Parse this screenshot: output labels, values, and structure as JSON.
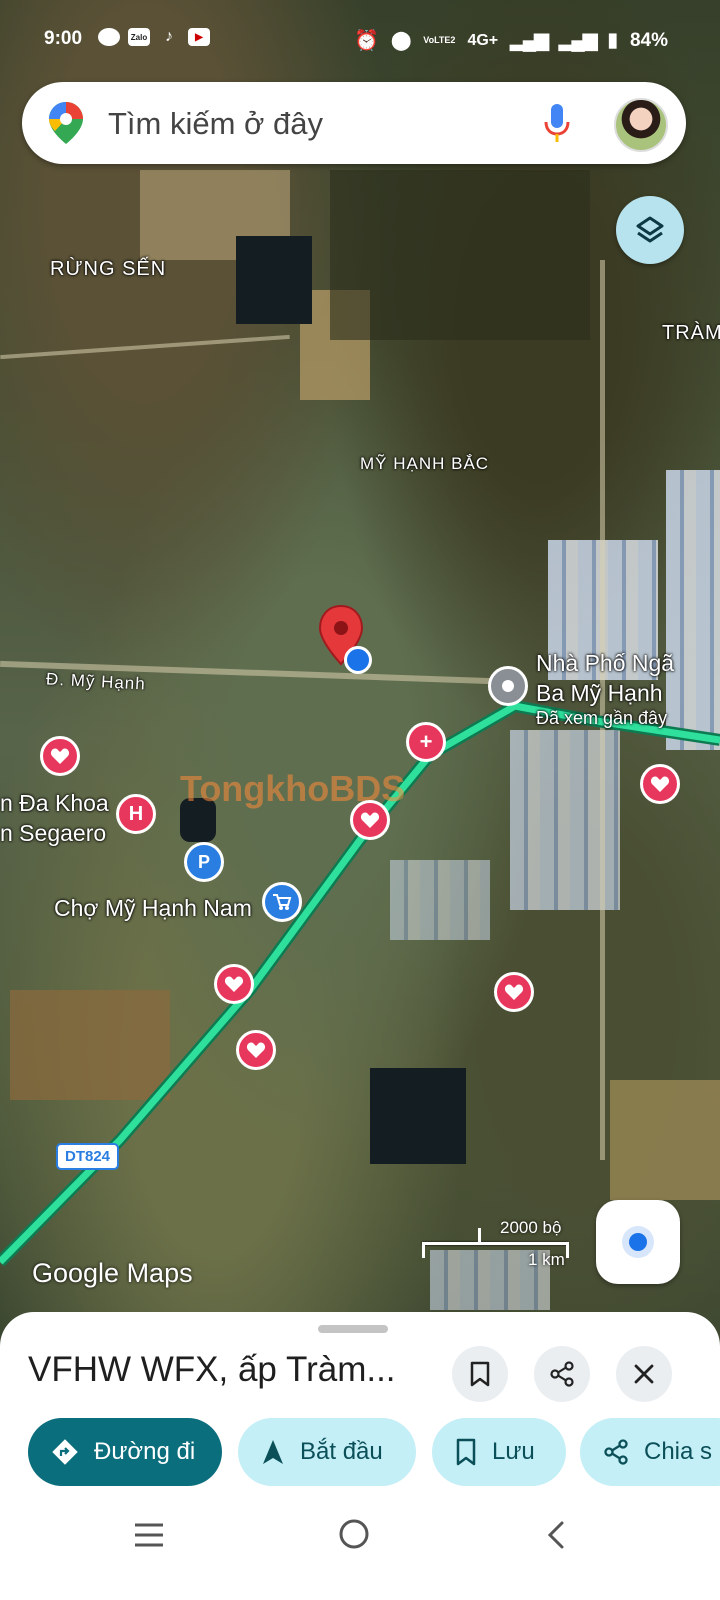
{
  "status_bar": {
    "time": "9:00",
    "app_icons": [
      "chat-icon",
      "zalo-icon",
      "tiktok-icon",
      "youtube-icon"
    ],
    "network": "4G+",
    "volte": "VoLTE2",
    "battery": "84%"
  },
  "search": {
    "placeholder": "Tìm kiếm ở đây"
  },
  "map": {
    "labels": {
      "rung_sen": "RỪNG SẾN",
      "tram": "TRÀM",
      "my_hanh_bac": "MỸ HẠNH BẮC",
      "duong_my_hanh": "Đ. Mỹ Hạnh",
      "place_line1": "Nhà Phố Ngã",
      "place_line2": "Ba Mỹ Hạnh",
      "place_sub": "Đã xem gần đây",
      "hospital_line1": "n Đa Khoa",
      "hospital_line2": "n Segaero",
      "market": "Chợ Mỹ Hạnh Nam",
      "route": "DT824"
    },
    "watermark": "TongkhoBDS",
    "logo": "Google Maps",
    "scale_imperial": "2000 bộ",
    "scale_metric": "1 km"
  },
  "place": {
    "title": "VFHW WFX, ấp Tràm..."
  },
  "actions": {
    "directions": "Đường đi",
    "start": "Bắt đầu",
    "save": "Lưu",
    "share": "Chia s"
  },
  "colors": {
    "primary": "#0b6e7d",
    "secondary": "#c4eff6",
    "route": "#1fbf7f",
    "pin": "#e8375d"
  }
}
